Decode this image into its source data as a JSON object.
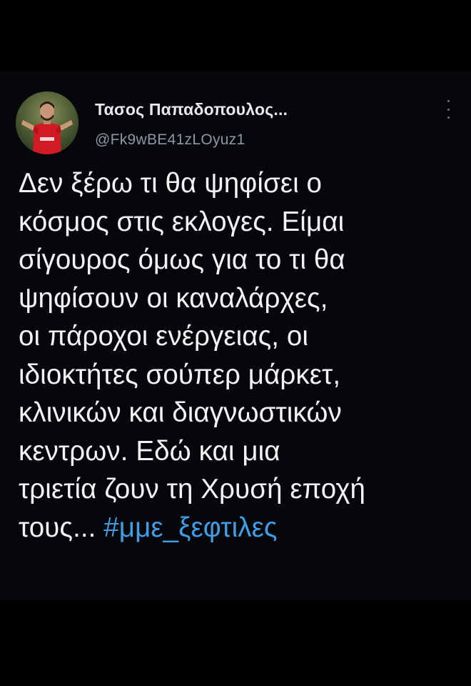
{
  "tweet": {
    "author_name": "Τασος Παπαδοπουλος...",
    "author_handle": "@Fk9wBE41zLOyuz1",
    "more_icon": "more-vertical-icon",
    "avatar_icon": "profile-photo-footballer",
    "text_lines": [
      "Δεν ξέρω τι θα ψηφίσει ο",
      "κόσμος στις εκλογες. Είμαι",
      "σίγουρος όμως για το τι θα",
      "ψηφίσουν οι καναλάρχες,",
      "οι πάροχοι ενέργειας, οι",
      "ιδιοκτήτες σούπερ μάρκετ,",
      "κλινικών και διαγνωστικών",
      "κεντρων. Εδώ και μια",
      "τριετία ζουν τη Χρυσή εποχή"
    ],
    "last_line_text": "τους... ",
    "hashtag": "#μμε_ξεφτιλες",
    "colors": {
      "background": "#000000",
      "text": "#f1f3f4",
      "handle": "#8b98a5",
      "hashtag": "#3f9ee6"
    }
  }
}
